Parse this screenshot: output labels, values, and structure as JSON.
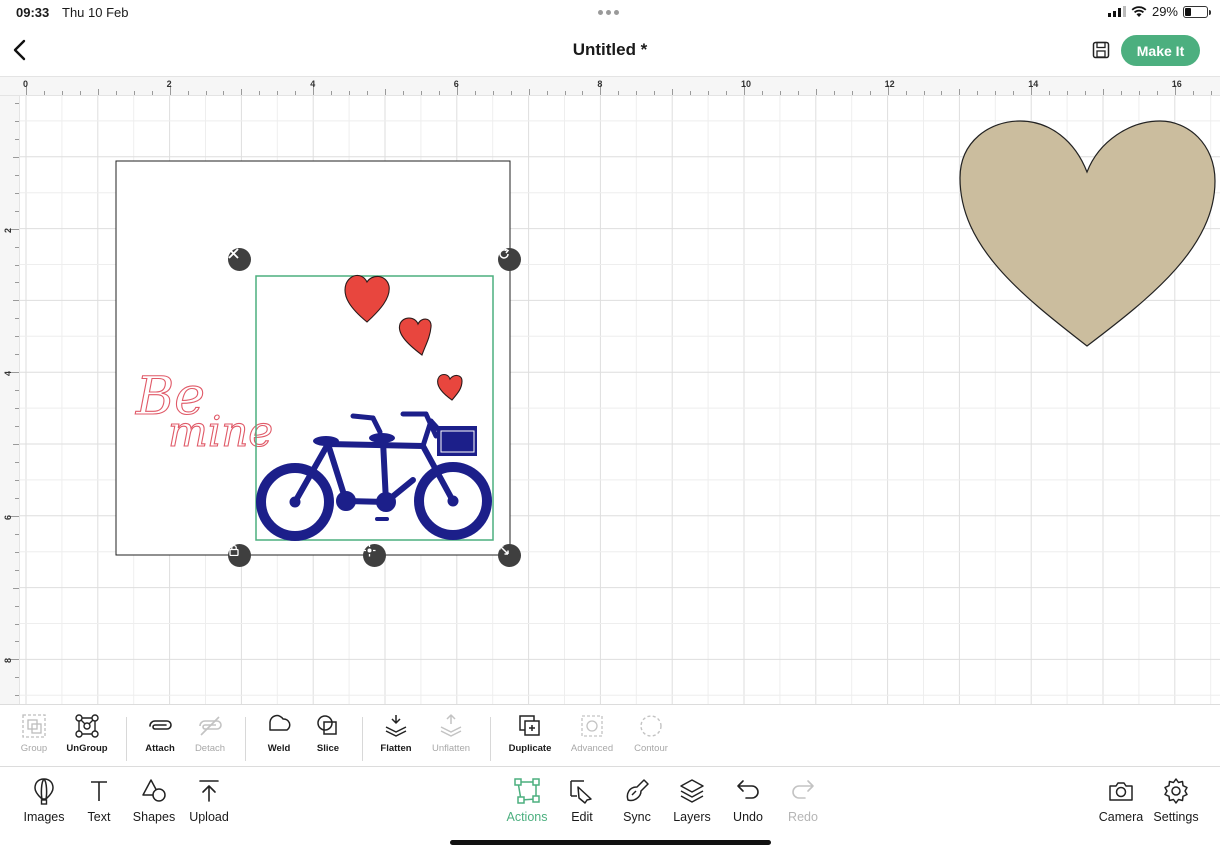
{
  "status_bar": {
    "time": "09:33",
    "date": "Thu 10 Feb",
    "battery": "29%",
    "battery_level": 0.29
  },
  "header": {
    "title": "Untitled *",
    "make_it_label": "Make It"
  },
  "ruler": {
    "top_labels": [
      "0",
      "2",
      "4",
      "6",
      "8",
      "10",
      "12",
      "14",
      "16"
    ],
    "left_labels": [
      "2",
      "4",
      "6",
      "8"
    ]
  },
  "canvas": {
    "be_mine_line1": "Be",
    "be_mine_line2": "mine"
  },
  "colors": {
    "accent": "#4caf7f",
    "bike_navy": "#1c1f8a",
    "heart_red": "#e8463e",
    "heart_tan": "#cbbd9e",
    "be_mine_pink": "#e05a68"
  },
  "actions": [
    {
      "label": "Group",
      "enabled": false,
      "icon": "group-icon"
    },
    {
      "label": "UnGroup",
      "enabled": true,
      "icon": "ungroup-icon"
    },
    {
      "label": "Attach",
      "enabled": true,
      "icon": "paperclip-icon"
    },
    {
      "label": "Detach",
      "enabled": false,
      "icon": "detach-icon"
    },
    {
      "label": "Weld",
      "enabled": true,
      "icon": "weld-icon"
    },
    {
      "label": "Slice",
      "enabled": true,
      "icon": "slice-icon"
    },
    {
      "label": "Flatten",
      "enabled": true,
      "icon": "flatten-icon"
    },
    {
      "label": "Unflatten",
      "enabled": false,
      "icon": "unflatten-icon"
    },
    {
      "label": "Duplicate",
      "enabled": true,
      "icon": "duplicate-icon"
    },
    {
      "label": "Advanced",
      "enabled": false,
      "icon": "advanced-icon"
    },
    {
      "label": "Contour",
      "enabled": false,
      "icon": "contour-icon"
    }
  ],
  "bottom_nav": [
    {
      "label": "Images",
      "icon": "balloon-icon"
    },
    {
      "label": "Text",
      "icon": "text-icon"
    },
    {
      "label": "Shapes",
      "icon": "shapes-icon"
    },
    {
      "label": "Upload",
      "icon": "upload-icon"
    },
    {
      "label": "Actions",
      "icon": "actions-icon",
      "active": true
    },
    {
      "label": "Edit",
      "icon": "edit-icon"
    },
    {
      "label": "Sync",
      "icon": "sync-icon"
    },
    {
      "label": "Layers",
      "icon": "layers-icon"
    },
    {
      "label": "Undo",
      "icon": "undo-icon"
    },
    {
      "label": "Redo",
      "icon": "redo-icon",
      "enabled": false
    },
    {
      "label": "Camera",
      "icon": "camera-icon"
    },
    {
      "label": "Settings",
      "icon": "settings-icon"
    }
  ]
}
